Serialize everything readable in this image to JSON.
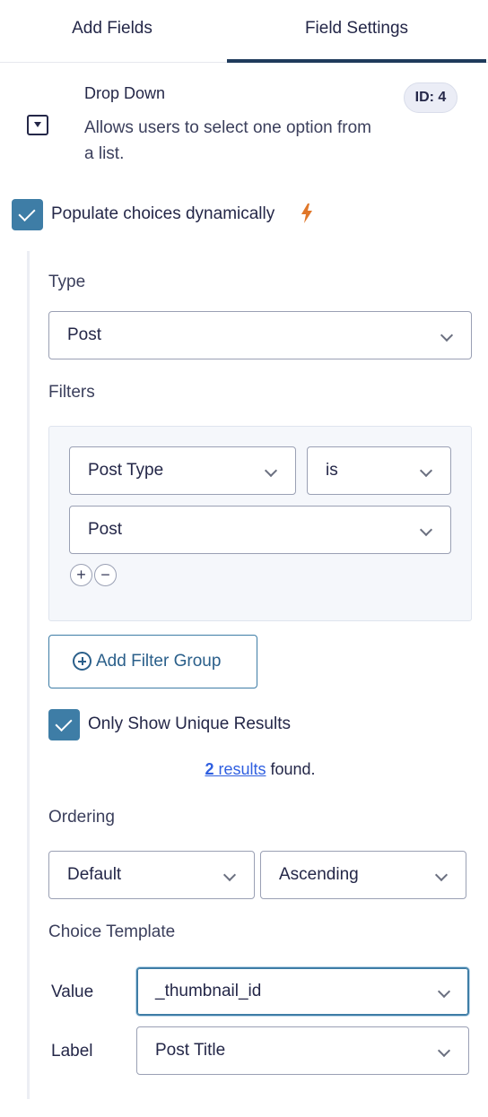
{
  "tabs": {
    "add_fields": "Add Fields",
    "field_settings": "Field Settings"
  },
  "field": {
    "title": "Drop Down",
    "description": "Allows users to select one option from a list.",
    "id_badge": "ID: 4",
    "icon": "dropdown-field-icon"
  },
  "populate": {
    "label": "Populate choices dynamically",
    "checked": true,
    "bolt_color": "#e0772a"
  },
  "type": {
    "label": "Type",
    "value": "Post"
  },
  "filters": {
    "label": "Filters",
    "property": "Post Type",
    "operator": "is",
    "value": "Post",
    "add_glyph": "+",
    "remove_glyph": "−"
  },
  "add_filter_group": "Add Filter Group",
  "unique": {
    "label": "Only Show Unique Results",
    "checked": true
  },
  "results": {
    "count": "2",
    "link_word": "results",
    "suffix": "found."
  },
  "ordering": {
    "label": "Ordering",
    "by": "Default",
    "direction": "Ascending"
  },
  "choice_template": {
    "label": "Choice Template",
    "value_label": "Value",
    "value": "_thumbnail_id",
    "label_label": "Label",
    "label_value": "Post Title"
  },
  "colors": {
    "accent": "#3e7da6",
    "tab_underline": "#1f3b5c",
    "link": "#2f5fe0"
  }
}
